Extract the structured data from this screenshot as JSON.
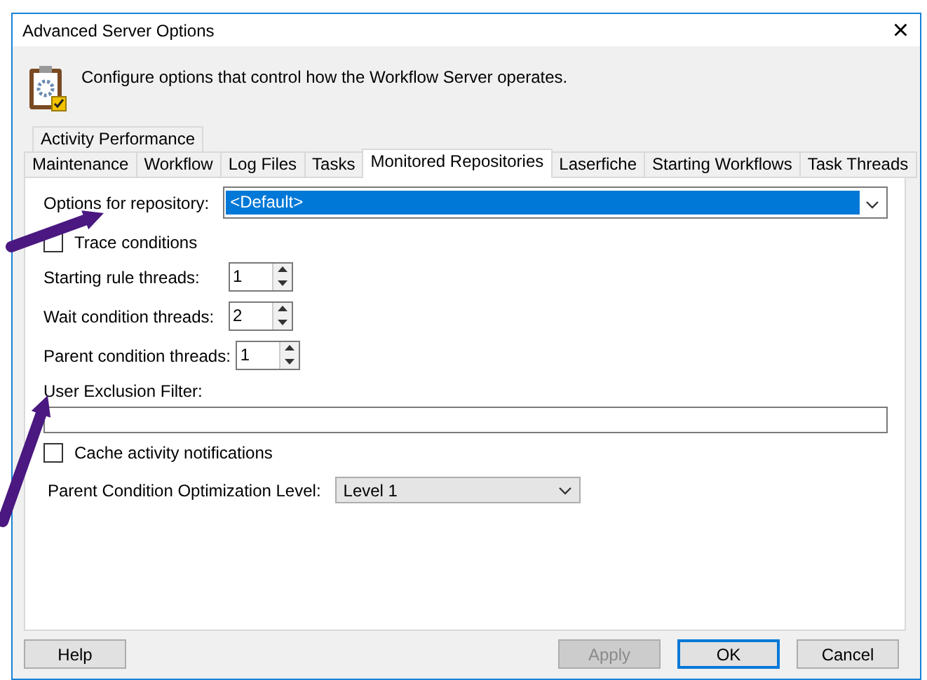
{
  "window": {
    "title": "Advanced Server Options",
    "close": "×"
  },
  "description": "Configure options that control how the Workflow Server operates.",
  "tab_rows": [
    [
      {
        "label": "Activity Performance",
        "selected": false
      }
    ],
    [
      {
        "label": "Maintenance",
        "selected": false
      },
      {
        "label": "Workflow",
        "selected": false
      },
      {
        "label": "Log Files",
        "selected": false
      },
      {
        "label": "Tasks",
        "selected": false
      },
      {
        "label": "Monitored Repositories",
        "selected": true
      },
      {
        "label": "Laserfiche",
        "selected": false
      },
      {
        "label": "Starting Workflows",
        "selected": false
      },
      {
        "label": "Task Threads",
        "selected": false
      }
    ]
  ],
  "repository": {
    "label": "Options for repository:",
    "value": "<Default>",
    "selected": true
  },
  "trace_conditions": {
    "label": "Trace conditions",
    "checked": false
  },
  "spinners": [
    {
      "label": "Starting rule threads:",
      "value": "1"
    },
    {
      "label": "Wait condition threads:",
      "value": "2"
    },
    {
      "label": "Parent condition threads:",
      "value": "1"
    }
  ],
  "user_exclusion_filter": {
    "label": "User Exclusion Filter:"
  },
  "cache_notifications": {
    "label": "Cache activity notifications",
    "checked": false
  },
  "optimization_level": {
    "label": "Parent Condition Optimization Level:",
    "value": "Level 1"
  },
  "buttons": [
    {
      "label": "Help",
      "disabled": false,
      "default": false
    },
    {
      "label": "Apply",
      "disabled": true,
      "default": false
    },
    {
      "label": "OK",
      "disabled": false,
      "default": true
    },
    {
      "label": "Cancel",
      "disabled": false,
      "default": false
    }
  ]
}
